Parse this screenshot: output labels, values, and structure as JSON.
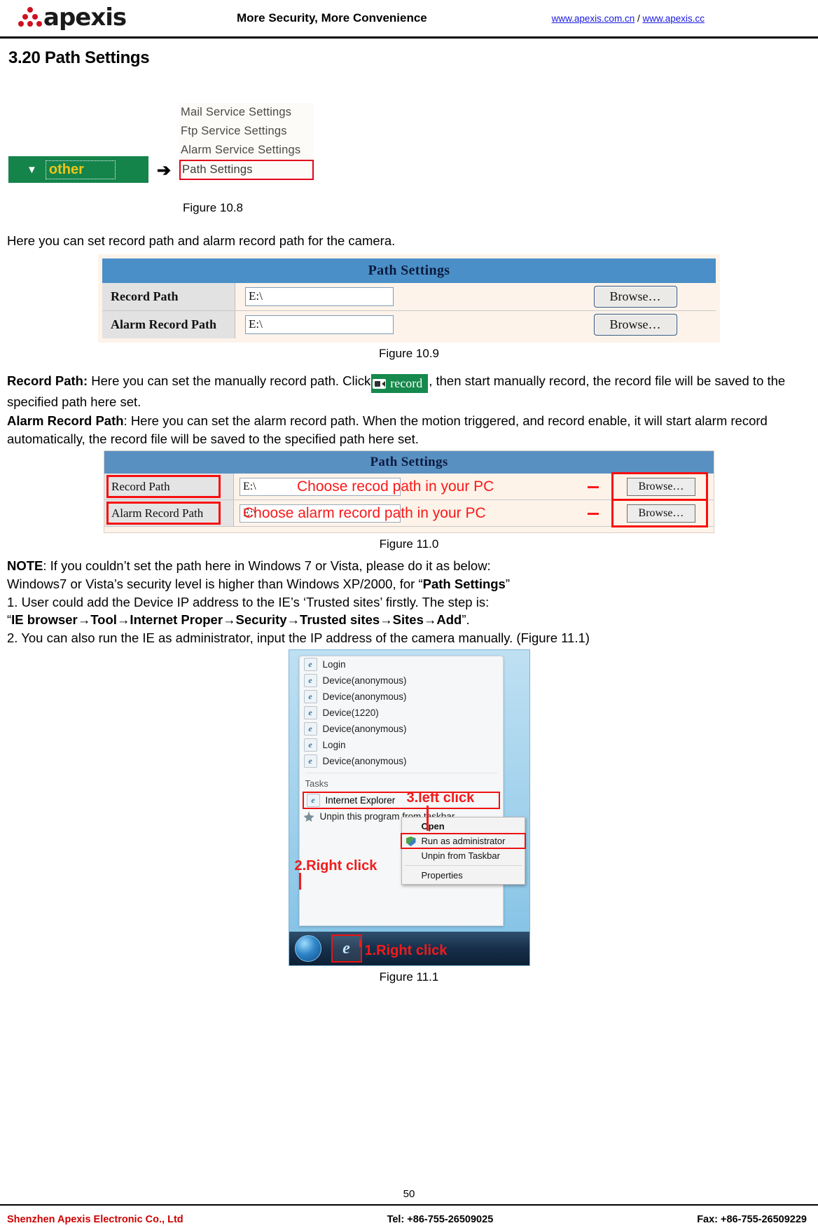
{
  "header": {
    "logo_text": "apexis",
    "tagline": "More Security, More Convenience",
    "link1": "www.apexis.com.cn",
    "link_sep": " / ",
    "link2": "www.apexis.cc"
  },
  "section": {
    "title": "3.20 Path Settings"
  },
  "figure_10_8": {
    "other_tab_label": "other",
    "caret_glyph": "▼",
    "arrow_glyph": "➔",
    "menu_items": [
      "Mail Service Settings",
      "Ftp Service Settings",
      "Alarm Service Settings",
      "Path Settings"
    ],
    "highlighted_item": "Path Settings",
    "caption": "Figure 10.8"
  },
  "intro_text": "Here you can set record path and alarm record path for the camera.",
  "figure_10_9": {
    "panel_title": "Path Settings",
    "rows": [
      {
        "label": "Record Path",
        "value": "E:\\",
        "button": "Browse…"
      },
      {
        "label": "Alarm Record Path",
        "value": "E:\\",
        "button": "Browse…"
      }
    ],
    "caption": "Figure 10.9"
  },
  "record_path_para": {
    "label": "Record Path:",
    "text_before": " Here you can set the manually record path. Click",
    "badge_label": "record",
    "text_after": ", then start manually record, the record file will be saved to the specified path here set."
  },
  "alarm_record_path_para": {
    "label": "Alarm Record Path",
    "text": ": Here you can set the alarm record path. When the motion triggered, and record enable, it will start alarm record automatically, the record file will be saved to the specified path here set."
  },
  "figure_11_0": {
    "panel_title": "Path Settings",
    "rows": [
      {
        "label": "Record Path",
        "value": "E:\\",
        "button": "Browse…",
        "annotation": "Choose recod path in your PC"
      },
      {
        "label": "Alarm Record Path",
        "value": "E:\\",
        "button": "Browse…",
        "annotation": "Choose alarm record path in your PC"
      }
    ],
    "caption": "Figure 11.0"
  },
  "note": {
    "label": "NOTE",
    "line1_rest": ": If you couldn’t set the path here in Windows 7 or Vista, please do it as below:",
    "line2_a": "Windows7 or Vista’s security level is higher than Windows XP/2000, for “",
    "line2_bold": "Path Settings",
    "line2_b": "”",
    "line3": "1. User could add the Device IP address to the IE’s ‘Trusted sites’ firstly. The step is:",
    "line4_quote_open": "“",
    "line4_bold": "IE browser→Tool→Internet Proper→Security→Trusted sites→Sites→Add",
    "line4_quote_close": "”.",
    "line5": "2. You can also run the IE as administrator, input the IP address of the camera manually. (Figure 11.1)"
  },
  "figure_11_1": {
    "jumplist_items": [
      "Login",
      "Device(anonymous)",
      "Device(anonymous)",
      "Device(1220)",
      "Device(anonymous)",
      "Login",
      "Device(anonymous)"
    ],
    "tasks_label": "Tasks",
    "pinned_app": "Internet Explorer",
    "unpin_program": "Unpin this program from taskbar",
    "context_menu": [
      "Open",
      "Run as administrator",
      "Unpin from Taskbar",
      "Properties"
    ],
    "annotation_3": "3.left click",
    "annotation_2": "2.Right click",
    "annotation_1": "1.Right click",
    "caption": "Figure 11.1"
  },
  "footer": {
    "page_number": "50",
    "company": "Shenzhen Apexis Electronic Co., Ltd",
    "tel": "Tel: +86-755-26509025",
    "fax": "Fax: +86-755-26509229"
  },
  "colors": {
    "brand_red": "#cc0000",
    "green_tab": "#14844a",
    "panel_blue": "#4a8fc7",
    "annotation_red": "#f21b1b",
    "link_blue": "#1a1ae0"
  }
}
